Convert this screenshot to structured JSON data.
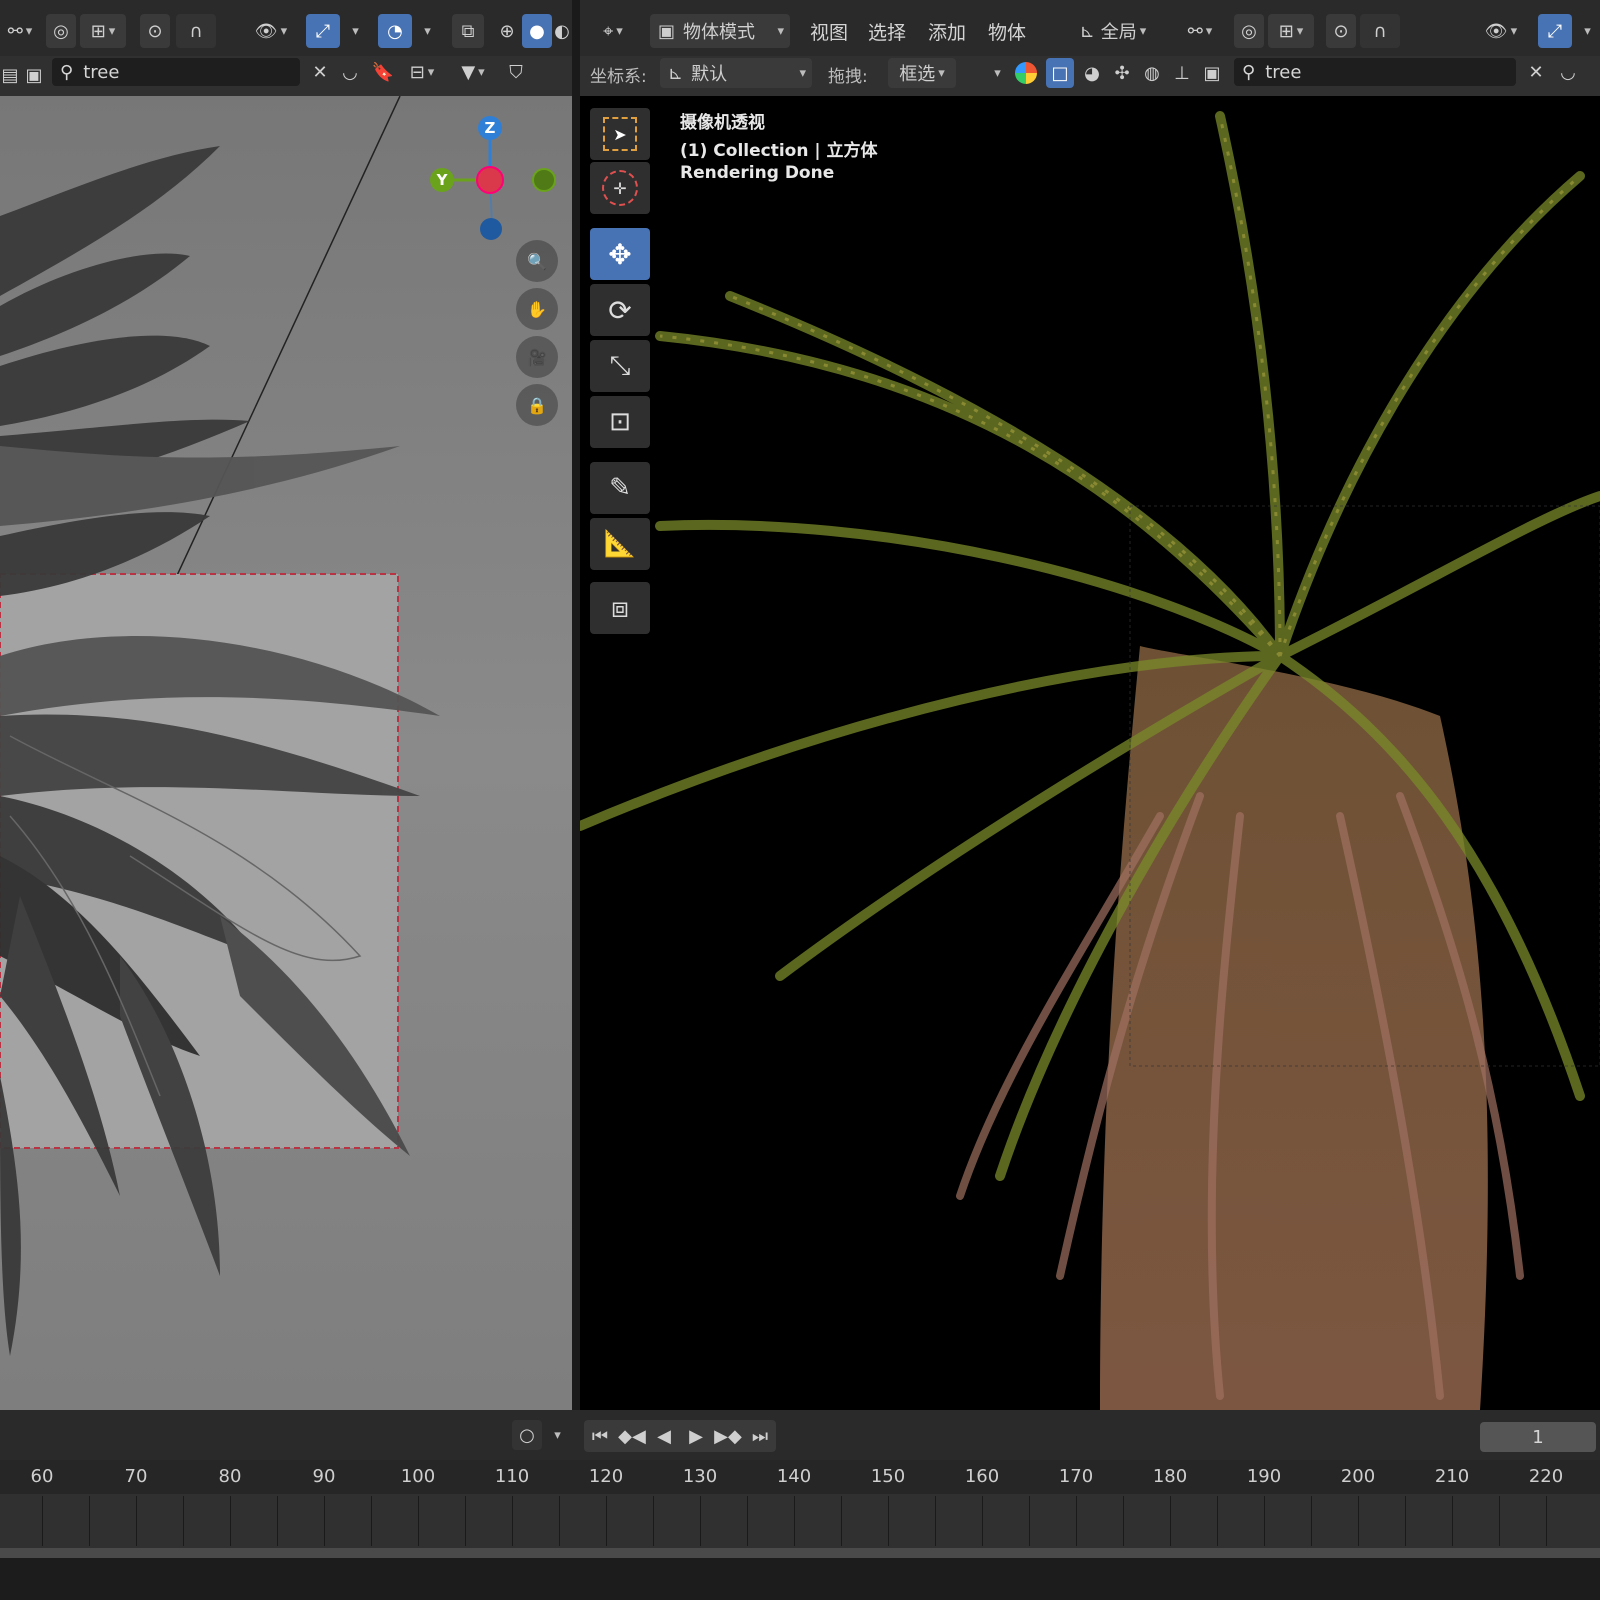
{
  "left_header": {
    "search_value": "tree"
  },
  "right_header": {
    "mode_label": "物体模式",
    "menus": [
      "视图",
      "选择",
      "添加",
      "物体"
    ],
    "transform_label": "全局",
    "coord_label": "坐标系:",
    "coord_value": "默认",
    "drag_label": "拖拽:",
    "drag_value": "框选",
    "search_value": "tree"
  },
  "viewport_overlay": {
    "view_name": "摄像机透视",
    "collection": "(1) Collection | 立方体",
    "status": "Rendering Done"
  },
  "gizmo": {
    "z": "Z",
    "y": "Y"
  },
  "timeline": {
    "current_frame": "1",
    "ticks": [
      "60",
      "70",
      "80",
      "90",
      "100",
      "110",
      "120",
      "130",
      "140",
      "150",
      "160",
      "170",
      "180",
      "190",
      "200",
      "210",
      "220"
    ]
  },
  "colors": {
    "accent": "#4772b3",
    "axis_x": "#d9394a",
    "axis_y": "#6aa31b",
    "axis_z": "#2f7fd6"
  }
}
